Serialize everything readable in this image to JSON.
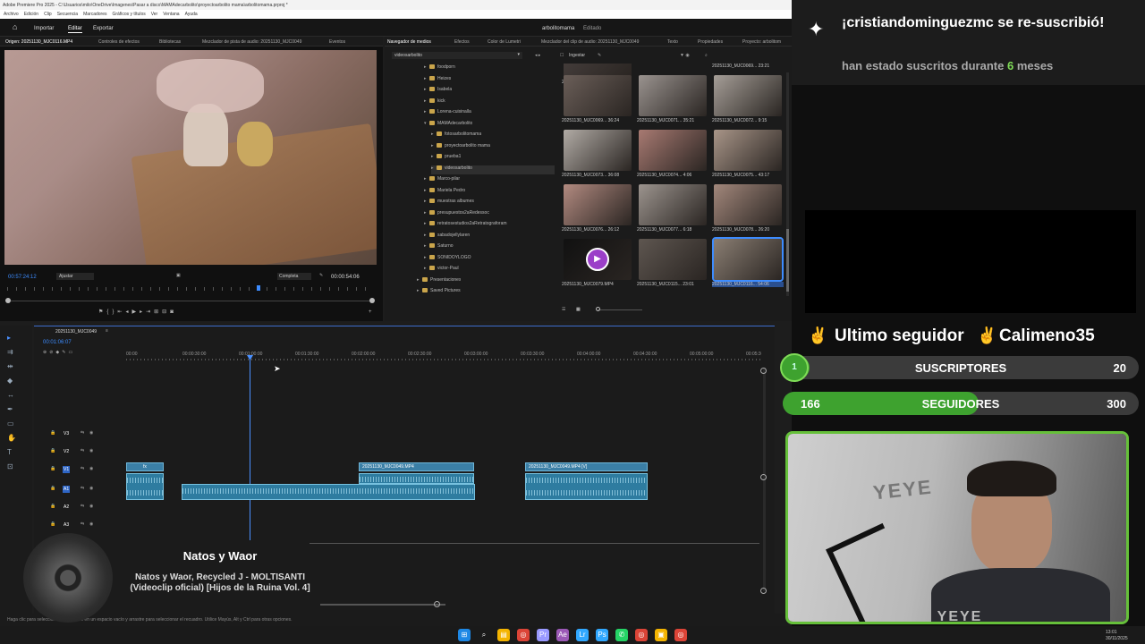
{
  "window": {
    "title": "Adobe Premiere Pro 2025 - C:\\Usuarios\\milo\\OneDrive\\Imagenes\\Pasar a disco\\MAMAdecarbolito\\proyectoarbolito mama\\arbolitomama.prproj *",
    "menu": [
      "Archivo",
      "Edición",
      "Clip",
      "Secuencia",
      "Marcadores",
      "Gráficos y títulos",
      "Ver",
      "Ventana",
      "Ayuda"
    ]
  },
  "header": {
    "home_icon": "home-icon",
    "nav": [
      "Importar",
      "Editar",
      "Exportar"
    ],
    "active_nav": "Editar",
    "project_name": "arbolitomama",
    "edited_label": "Editado"
  },
  "source_panel": {
    "tabs": [
      "Origen: 20251130_MJC0116.MP4",
      "Controles de efectos",
      "Bibliotecas",
      "Mezclador de pista de audio: 20251130_MJC0049",
      "Eventos"
    ],
    "timecode_in": "00:57:24:12",
    "fit": "Ajustar",
    "quality": "Completa",
    "duration": "00:00:54:06"
  },
  "media_panel": {
    "tabs": [
      "Navegador de medios",
      "Efectos",
      "Color de Lumetri",
      "Mezclador del clip de audio: 20251130_MJC0049",
      "Texto",
      "Propiedades",
      "Proyecto: arbolitom"
    ],
    "path": "videosarbolito",
    "ingest": "Ingestar",
    "folders": [
      {
        "name": "foodporn",
        "indent": 0,
        "open": false
      },
      {
        "name": "Heizes",
        "indent": 0,
        "open": false
      },
      {
        "name": "Isabela",
        "indent": 0,
        "open": false
      },
      {
        "name": "kick",
        "indent": 0,
        "open": false
      },
      {
        "name": "Lorena-cuisinalla",
        "indent": 0,
        "open": false
      },
      {
        "name": "MAMAdecarbolito",
        "indent": 0,
        "open": true
      },
      {
        "name": "fotosarbolitomama",
        "indent": 1,
        "open": false
      },
      {
        "name": "proyectoarbolito mama",
        "indent": 1,
        "open": false
      },
      {
        "name": "prueba1",
        "indent": 1,
        "open": false
      },
      {
        "name": "videosarbolito",
        "indent": 1,
        "open": false,
        "selected": true
      },
      {
        "name": "Marco-pilar",
        "indent": 0,
        "open": false
      },
      {
        "name": "Mariela Pedro",
        "indent": 0,
        "open": false
      },
      {
        "name": "muestras albumes",
        "indent": 0,
        "open": false
      },
      {
        "name": "presupuestos2aRedessoc",
        "indent": 0,
        "open": false
      },
      {
        "name": "retratosestudios2aRetratograforam",
        "indent": 0,
        "open": false
      },
      {
        "name": "sabadojellylaren",
        "indent": 0,
        "open": false
      },
      {
        "name": "Saturno",
        "indent": 0,
        "open": false
      },
      {
        "name": "SONIDOYLOGO",
        "indent": 0,
        "open": false
      },
      {
        "name": "victor-Paul",
        "indent": 0,
        "open": false
      },
      {
        "name": "Presentaciones",
        "indent": -1,
        "open": false
      },
      {
        "name": "Saved Pictures",
        "indent": -1,
        "open": false
      }
    ],
    "thumbs": [
      {
        "label": "20251130_MJC0069... 1:05:19",
        "tone": "#4b4341"
      },
      {
        "label": "20251130_MJC0069... 23:21",
        "tone": "#7a6b66"
      },
      {
        "label": "20251130_MJC0069... 36:24",
        "tone": "#6a5e58"
      },
      {
        "label": "20251130_MJC0071... 35:21",
        "tone": "#9a938f"
      },
      {
        "label": "20251130_MJC0072... 9:15",
        "tone": "#a59e97"
      },
      {
        "label": "20251130_MJC0073... 36:08",
        "tone": "#b1aba5"
      },
      {
        "label": "20251130_MJC0074... 4:06",
        "tone": "#a87a72"
      },
      {
        "label": "20251130_MJC0075... 43:17",
        "tone": "#a89588"
      },
      {
        "label": "20251130_MJC0076... 26:12",
        "tone": "#b28a80"
      },
      {
        "label": "20251130_MJC0077... 6:18",
        "tone": "#9c948e"
      },
      {
        "label": "20251130_MJC0078... 26:20",
        "tone": "#a2877b"
      },
      {
        "label": "20251130_MJC0079.MP4",
        "tone": "#111111",
        "play": true
      },
      {
        "label": "20251130_MJC0115... 23:01",
        "tone": "#5e5650"
      },
      {
        "label": "20251130_MJC0116... 54:06",
        "tone": "#8a7e73",
        "selected": true
      }
    ]
  },
  "timeline": {
    "sequence": "20251130_MJC0049",
    "timecode": "00:01:06:07",
    "ruler": [
      "00:00",
      "00:00:30:00",
      "00:01:00:00",
      "00:01:30:00",
      "00:02:00:00",
      "00:02:30:00",
      "00:03:00:00",
      "00:03:30:00",
      "00:04:00:00",
      "00:04:30:00",
      "00:05:00:00",
      "00:05:30:00"
    ],
    "tracks": [
      "V3",
      "V2",
      "V1",
      "A1",
      "A2",
      "A3"
    ],
    "clips": [
      {
        "label": "fx",
        "track": "V1"
      },
      {
        "label": "20251130_MJC0049.MP4",
        "track": "V1"
      },
      {
        "label": "20251130_MJC0049.MP4 [V]",
        "track": "V1"
      }
    ],
    "status": "Haga clic para seleccionar, o haga clic en un espacio vacío y arrastre para seleccionar el recuadro. Utilice Mayús, Alt y Ctrl para otras opciones."
  },
  "overlay": {
    "sub_user": "¡cristiandominguezmc se re-suscribió!",
    "sub_detail_pre": "han estado suscritos durante",
    "sub_months": "6",
    "sub_detail_post": "meses",
    "last_follower_label": "Ultimo seguidor",
    "last_follower_name": "Calimeno35",
    "subs_label": "SUSCRIPTORES",
    "subs_current": "1",
    "subs_goal": "20",
    "subs_progress": 0.05,
    "followers_label": "SEGUIDORES",
    "followers_current": "166",
    "followers_goal": "300",
    "followers_progress": 0.55,
    "cam_wall_text": "YEYE",
    "cam_badge": "YEYE",
    "accent": "#66c03a"
  },
  "now_playing": {
    "artist": "Natos y Waor",
    "track": "Natos y Waor, Recycled J - MOLTISANTI (Videoclip oficial) [Hijos de la Ruina Vol. 4]"
  },
  "taskbar": {
    "icons": [
      "windows-icon",
      "search-icon",
      "files-icon",
      "chrome-icon",
      "premiere-icon",
      "aftereffects-icon",
      "lightroom-icon",
      "photoshop-icon",
      "whatsapp-icon",
      "chrome2-icon",
      "folder-icon",
      "chrome3-icon"
    ],
    "time": "13:01",
    "date": "30/11/2025"
  }
}
